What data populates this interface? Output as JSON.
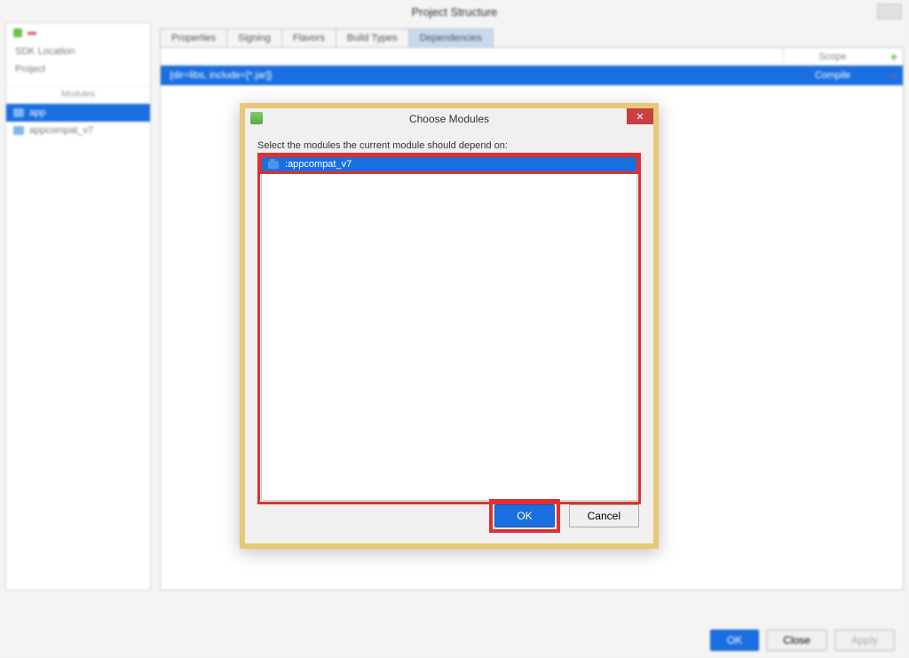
{
  "window_title": "Project Structure",
  "left_panel": {
    "items": [
      "SDK Location",
      "Project"
    ],
    "modules_header": "Modules",
    "modules": [
      {
        "label": "app",
        "selected": true
      },
      {
        "label": "appcompat_v7",
        "selected": false
      }
    ]
  },
  "tabs": [
    "Properties",
    "Signing",
    "Flavors",
    "Build Types",
    "Dependencies"
  ],
  "active_tab_index": 4,
  "dependencies": {
    "scope_header": "Scope",
    "rows": [
      {
        "name": "{dir=libs, include=[*.jar]}",
        "scope": "Compile"
      }
    ]
  },
  "bottom_buttons": {
    "ok": "OK",
    "cancel": "Close",
    "apply": "Apply"
  },
  "modal": {
    "title": "Choose Modules",
    "prompt": "Select the modules the current module should depend on:",
    "items": [
      {
        "label": ":appcompat_v7",
        "selected": true
      }
    ],
    "ok": "OK",
    "cancel": "Cancel"
  }
}
